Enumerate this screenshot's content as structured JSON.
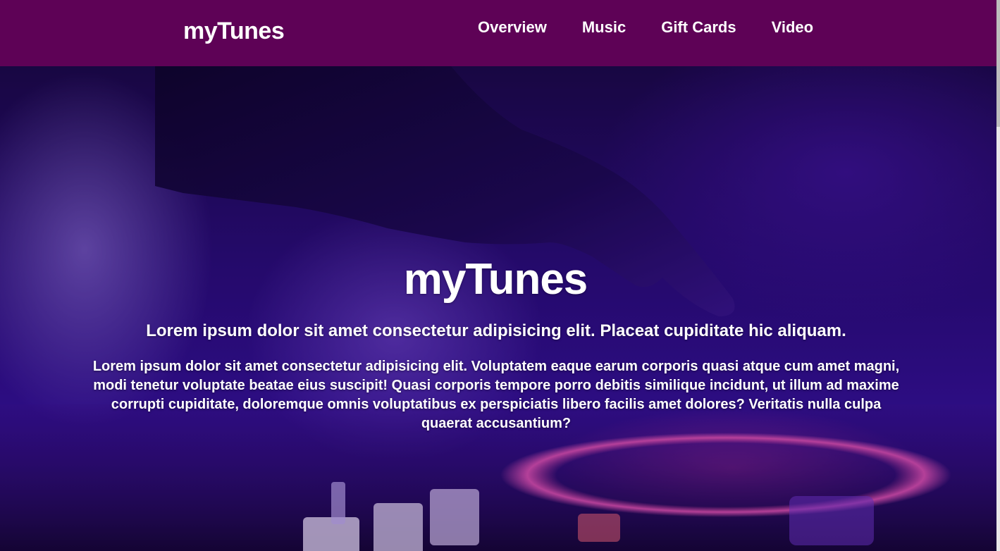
{
  "navbar": {
    "brand": "myTunes",
    "background_color": "#5e0256",
    "links": [
      {
        "label": "Overview"
      },
      {
        "label": "Music"
      },
      {
        "label": "Gift Cards"
      },
      {
        "label": "Video"
      }
    ]
  },
  "hero": {
    "background_image": "dj-turntable-hand-purple-lighting",
    "title": "myTunes",
    "subtitle": "Lorem ipsum dolor sit amet consectetur adipisicing elit. Placeat cupiditate hic aliquam.",
    "body": "Lorem ipsum dolor sit amet consectetur adipisicing elit. Voluptatem eaque earum corporis quasi atque cum amet magni, modi tenetur voluptate beatae eius suscipit! Quasi corporis tempore porro debitis similique incidunt, ut illum ad maxime corrupti cupiditate, doloremque omnis voluptatibus ex perspiciatis libero facilis amet dolores? Veritatis nulla culpa quaerat accusantium?"
  }
}
